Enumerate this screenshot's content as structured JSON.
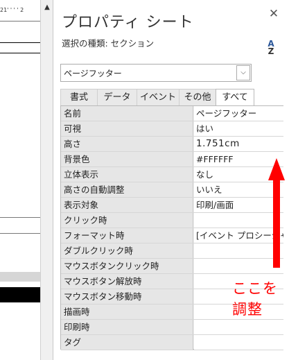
{
  "design_view": {
    "ruler_text": "21' ' ' ' 2",
    "scroll_up": "▲"
  },
  "pane": {
    "title": "プロパティ シート",
    "close_label": "✕",
    "selection_type": "選択の種類:  セクション",
    "sort_icon": "sort-az-icon",
    "combo_value": "ページフッター",
    "combo_arrow": "⌵",
    "tabs": [
      "書式",
      "データ",
      "イベント",
      "その他",
      "すべて"
    ],
    "active_tab": "すべて"
  },
  "properties": [
    {
      "name": "名前",
      "value": "ページフッター"
    },
    {
      "name": "可視",
      "value": "はい"
    },
    {
      "name": "高さ",
      "value": "1.751cm"
    },
    {
      "name": "背景色",
      "value": "#FFFFFF"
    },
    {
      "name": "立体表示",
      "value": "なし"
    },
    {
      "name": "高さの自動調整",
      "value": "いいえ"
    },
    {
      "name": "表示対象",
      "value": "印刷/画面"
    },
    {
      "name": "クリック時",
      "value": ""
    },
    {
      "name": "フォーマット時",
      "value": "[イベント プロシージャ"
    },
    {
      "name": "ダブルクリック時",
      "value": ""
    },
    {
      "name": "マウスボタンクリック時",
      "value": ""
    },
    {
      "name": "マウスボタン解放時",
      "value": ""
    },
    {
      "name": "マウスボタン移動時",
      "value": ""
    },
    {
      "name": "描画時",
      "value": ""
    },
    {
      "name": "印刷時",
      "value": ""
    },
    {
      "name": "タグ",
      "value": ""
    }
  ],
  "annotation": {
    "text": "ここを調整",
    "color": "#ff0000"
  }
}
